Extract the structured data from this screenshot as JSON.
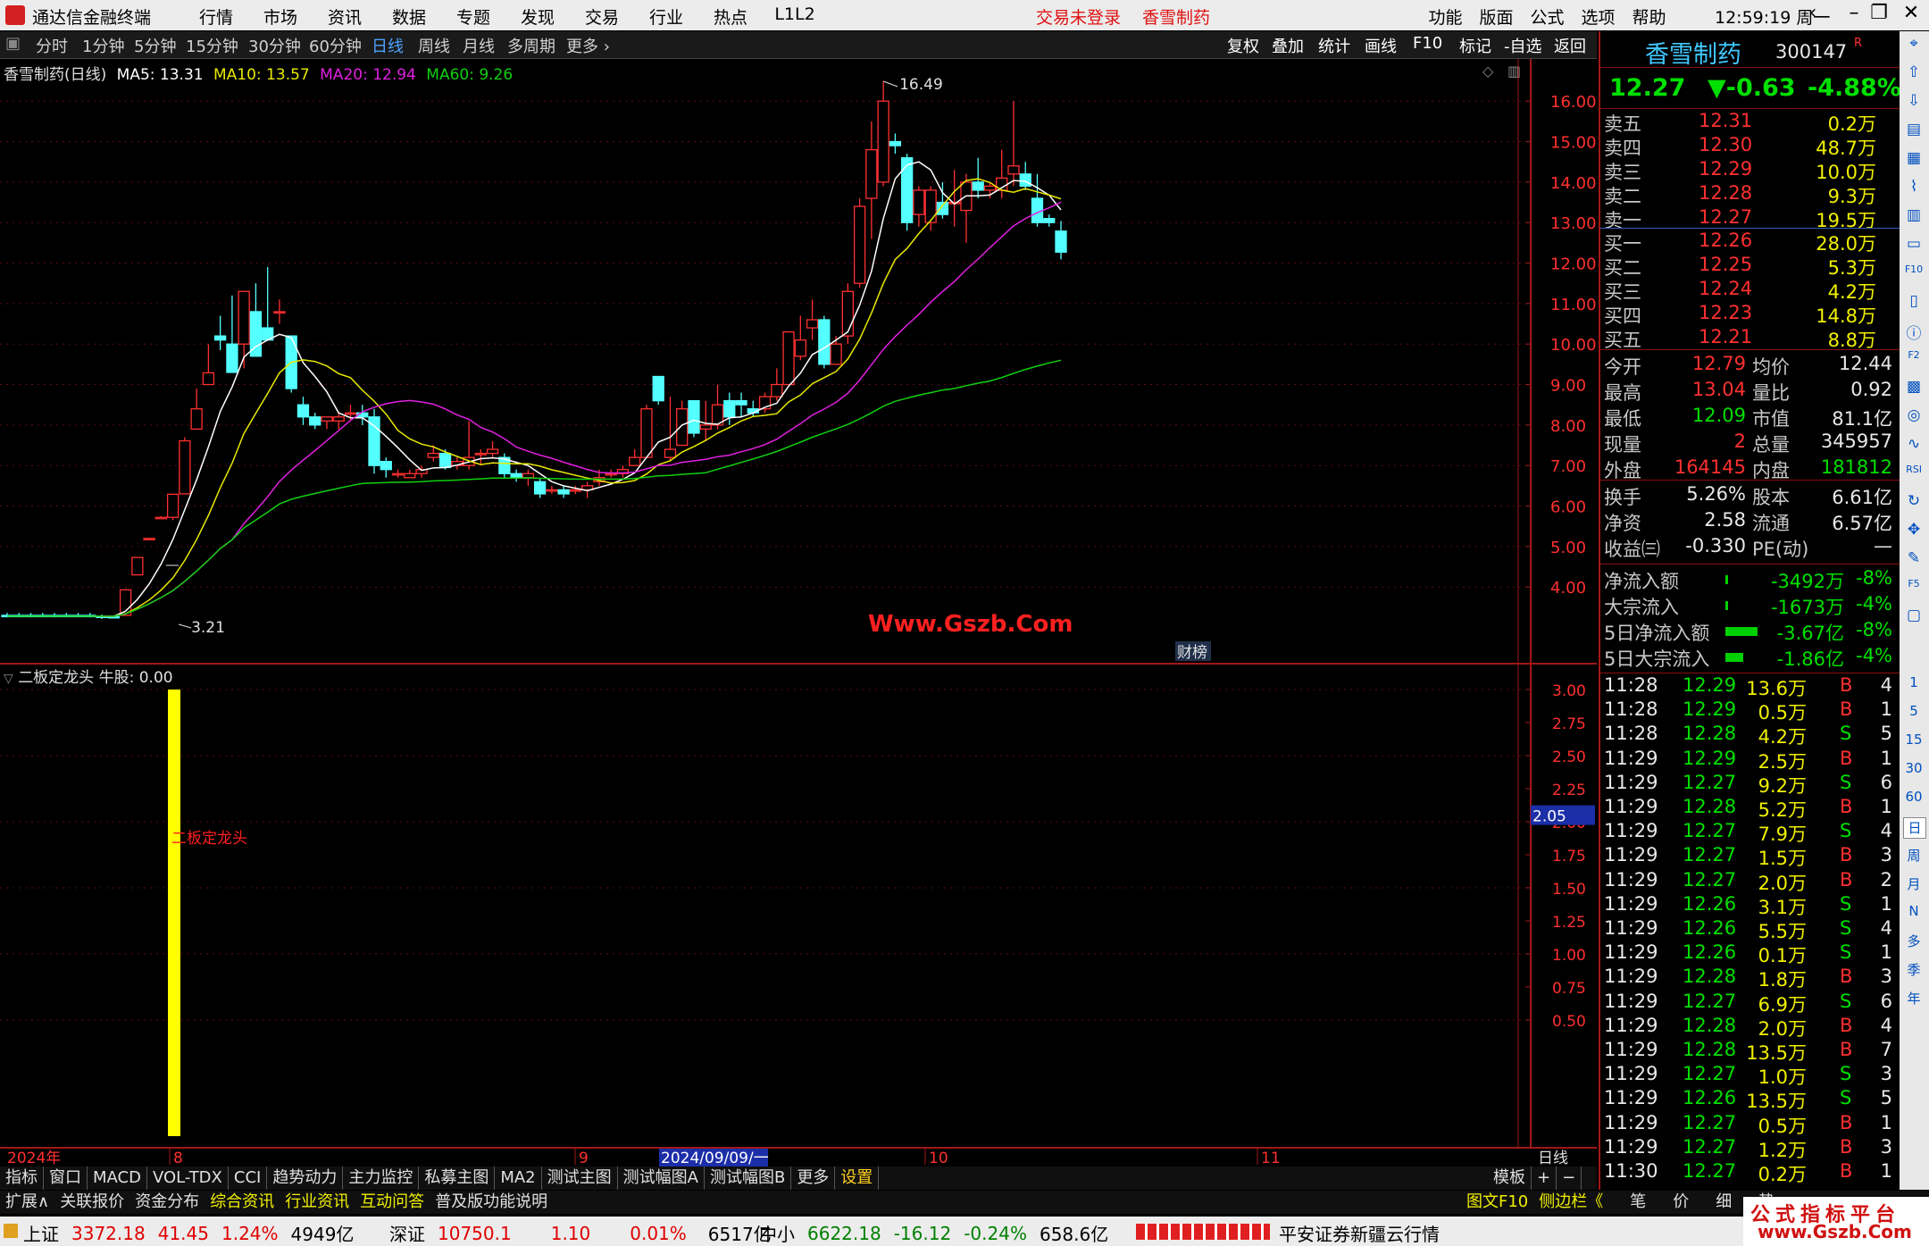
{
  "titlebar": {
    "app_title": "通达信金融终端",
    "menu": [
      "行情",
      "市场",
      "资讯",
      "数据",
      "专题",
      "发现",
      "交易",
      "行业",
      "热点",
      "L1L2"
    ],
    "center": [
      "交易未登录",
      "香雪制药"
    ],
    "right_menu": [
      "功能",
      "版面",
      "公式",
      "选项",
      "帮助"
    ],
    "clock": "12:59:19 周一",
    "win_buttons": [
      "‹",
      "‹",
      "❐",
      "✕"
    ]
  },
  "periodbar": {
    "items": [
      "分时",
      "1分钟",
      "5分钟",
      "15分钟",
      "30分钟",
      "60分钟",
      "日线",
      "周线",
      "月线",
      "多周期",
      "更多 ›"
    ],
    "active": "日线",
    "tools": [
      "复权",
      "叠加",
      "统计",
      "画线",
      "F10",
      "标记",
      "-自选",
      "返回"
    ]
  },
  "mainchart": {
    "legend": {
      "name": "香雪制药(日线)",
      "ma5": "MA5: 13.31",
      "ma10": "MA10: 13.57",
      "ma20": "MA20: 12.94",
      "ma60": "MA60: 9.26"
    },
    "colors": {
      "up": "#ff3030",
      "down": "#54ffff",
      "ma5": "#ffffff",
      "ma10": "#e8e800",
      "ma20": "#e020e0",
      "ma60": "#10d010"
    },
    "y_ticks": [
      "16.00",
      "15.00",
      "14.00",
      "13.00",
      "12.00",
      "11.00",
      "10.00",
      "9.00",
      "8.00",
      "7.00",
      "6.00",
      "5.00",
      "4.00"
    ],
    "y_tick_values": [
      16,
      15,
      14,
      13,
      12,
      11,
      10,
      9,
      8,
      7,
      6,
      5,
      4
    ],
    "high_label": "16.49",
    "low_label": "3.21",
    "annotation": "财榜",
    "watermark": "Www.Gszb.Com"
  },
  "subchart": {
    "legend": "二板定龙头  牛股: 0.00",
    "indicator_text": "二板定龙头",
    "y_ticks": [
      "3.00",
      "2.75",
      "2.50",
      "2.25",
      "2.00",
      "1.75",
      "1.50",
      "1.25",
      "1.00",
      "0.75",
      "0.50"
    ],
    "current_value": "2.05",
    "bar_value": 3.0
  },
  "xaxis": {
    "labels": [
      "2024年",
      "8",
      "9",
      "2024/09/09/一",
      "10",
      "11"
    ],
    "period": "日线"
  },
  "tabbar1": {
    "items": [
      "指标",
      "窗口",
      "MACD",
      "VOL-TDX",
      "CCI",
      "趋势动力",
      "主力监控",
      "私募主图",
      "MA2",
      "测试主图",
      "测试幅图A",
      "测试幅图B",
      "更多",
      "设置"
    ],
    "right": [
      "模板",
      "+",
      "−"
    ]
  },
  "tabbar2": {
    "items": [
      "扩展∧",
      "关联报价",
      "资金分布",
      "综合资讯",
      "行业资讯",
      "互动问答",
      "普及版功能说明"
    ],
    "right": [
      "图文F10",
      "侧边栏《",
      "笔",
      "价",
      "细",
      "势"
    ]
  },
  "statusbar": {
    "indices": [
      {
        "name": "上证",
        "value": "3372.18",
        "change": "41.45",
        "pct": "1.24%",
        "amount": "4949亿"
      },
      {
        "name": "深证",
        "value": "10750.1",
        "change": "1.10",
        "pct": "0.01%",
        "amount": "6517亿"
      },
      {
        "name": "中小",
        "value": "6622.18",
        "change": "-16.12",
        "pct": "-0.24%",
        "amount": "658.6亿"
      }
    ],
    "broker": "平安证券新疆云行情"
  },
  "quote": {
    "name": "香雪制药",
    "code": "300147",
    "price": "12.27",
    "change": "▼-0.63",
    "pct": "-4.88%",
    "asks": [
      {
        "label": "卖五",
        "price": "12.31",
        "vol": "0.2万"
      },
      {
        "label": "卖四",
        "price": "12.30",
        "vol": "48.7万"
      },
      {
        "label": "卖三",
        "price": "12.29",
        "vol": "10.0万"
      },
      {
        "label": "卖二",
        "price": "12.28",
        "vol": "9.3万"
      },
      {
        "label": "卖一",
        "price": "12.27",
        "vol": "19.5万"
      }
    ],
    "bids": [
      {
        "label": "买一",
        "price": "12.26",
        "vol": "28.0万"
      },
      {
        "label": "买二",
        "price": "12.25",
        "vol": "5.3万"
      },
      {
        "label": "买三",
        "price": "12.24",
        "vol": "4.2万"
      },
      {
        "label": "买四",
        "price": "12.23",
        "vol": "14.8万"
      },
      {
        "label": "买五",
        "price": "12.21",
        "vol": "8.8万"
      }
    ],
    "stats": [
      [
        "今开",
        "12.79",
        "均价",
        "12.44"
      ],
      [
        "最高",
        "13.04",
        "量比",
        "0.92"
      ],
      [
        "最低",
        "12.09",
        "市值",
        "81.1亿"
      ],
      [
        "现量",
        "2",
        "总量",
        "345957"
      ],
      [
        "外盘",
        "164145",
        "内盘",
        "181812"
      ]
    ],
    "stats2": [
      [
        "换手",
        "5.26%",
        "股本",
        "6.61亿"
      ],
      [
        "净资",
        "2.58",
        "流通",
        "6.57亿"
      ],
      [
        "收益㈢",
        "-0.330",
        "PE(动)",
        "—"
      ]
    ],
    "flows": [
      {
        "label": "净流入额",
        "value": "-3492万",
        "pct": "-8%"
      },
      {
        "label": "大宗流入",
        "value": "-1673万",
        "pct": "-4%"
      },
      {
        "label": "5日净流入额",
        "value": "-3.67亿",
        "pct": "-8%"
      },
      {
        "label": "5日大宗流入",
        "value": "-1.86亿",
        "pct": "-4%"
      }
    ],
    "ticks": [
      [
        "11:28",
        "12.29",
        "13.6万",
        "B",
        "4"
      ],
      [
        "11:28",
        "12.29",
        "0.5万",
        "B",
        "1"
      ],
      [
        "11:28",
        "12.28",
        "4.2万",
        "S",
        "5"
      ],
      [
        "11:29",
        "12.29",
        "2.5万",
        "B",
        "1"
      ],
      [
        "11:29",
        "12.27",
        "9.2万",
        "S",
        "6"
      ],
      [
        "11:29",
        "12.28",
        "5.2万",
        "B",
        "1"
      ],
      [
        "11:29",
        "12.27",
        "7.9万",
        "S",
        "4"
      ],
      [
        "11:29",
        "12.27",
        "1.5万",
        "B",
        "3"
      ],
      [
        "11:29",
        "12.27",
        "2.0万",
        "B",
        "2"
      ],
      [
        "11:29",
        "12.26",
        "3.1万",
        "S",
        "1"
      ],
      [
        "11:29",
        "12.26",
        "5.5万",
        "S",
        "4"
      ],
      [
        "11:29",
        "12.26",
        "0.1万",
        "S",
        "1"
      ],
      [
        "11:29",
        "12.28",
        "1.8万",
        "B",
        "3"
      ],
      [
        "11:29",
        "12.27",
        "6.9万",
        "S",
        "6"
      ],
      [
        "11:29",
        "12.28",
        "2.0万",
        "B",
        "4"
      ],
      [
        "11:29",
        "12.28",
        "13.5万",
        "B",
        "7"
      ],
      [
        "11:29",
        "12.27",
        "1.0万",
        "S",
        "3"
      ],
      [
        "11:29",
        "12.26",
        "13.5万",
        "S",
        "5"
      ],
      [
        "11:29",
        "12.27",
        "0.5万",
        "B",
        "1"
      ],
      [
        "11:29",
        "12.27",
        "1.2万",
        "B",
        "3"
      ],
      [
        "11:30",
        "12.27",
        "0.2万",
        "B",
        "1"
      ]
    ]
  },
  "sidebar": {
    "items": [
      "1",
      "5",
      "15",
      "30",
      "60",
      "日",
      "周",
      "月",
      "N",
      "多",
      "季",
      "年"
    ]
  },
  "brand": {
    "line1": "公式指标平台",
    "line2": "www.Gszb.Com"
  }
}
